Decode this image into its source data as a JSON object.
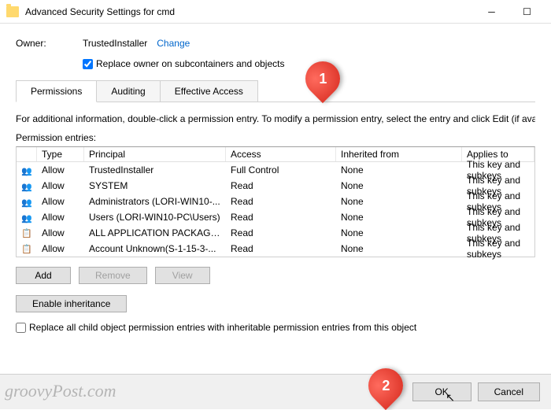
{
  "titlebar": {
    "title": "Advanced Security Settings for cmd"
  },
  "owner": {
    "label": "Owner:",
    "value": "TrustedInstaller",
    "change": "Change",
    "replace_checkbox": "Replace owner on subcontainers and objects",
    "replace_checked": true
  },
  "tabs": [
    {
      "label": "Permissions",
      "active": true
    },
    {
      "label": "Auditing",
      "active": false
    },
    {
      "label": "Effective Access",
      "active": false
    }
  ],
  "info": "For additional information, double-click a permission entry. To modify a permission entry, select the entry and click Edit (if availa",
  "entries_label": "Permission entries:",
  "columns": {
    "type": "Type",
    "principal": "Principal",
    "access": "Access",
    "inherited": "Inherited from",
    "applies": "Applies to"
  },
  "rows": [
    {
      "icon": "people",
      "type": "Allow",
      "principal": "TrustedInstaller",
      "access": "Full Control",
      "inherited": "None",
      "applies": "This key and subkeys"
    },
    {
      "icon": "people",
      "type": "Allow",
      "principal": "SYSTEM",
      "access": "Read",
      "inherited": "None",
      "applies": "This key and subkeys"
    },
    {
      "icon": "people",
      "type": "Allow",
      "principal": "Administrators (LORI-WIN10-...",
      "access": "Read",
      "inherited": "None",
      "applies": "This key and subkeys"
    },
    {
      "icon": "people",
      "type": "Allow",
      "principal": "Users (LORI-WIN10-PC\\Users)",
      "access": "Read",
      "inherited": "None",
      "applies": "This key and subkeys"
    },
    {
      "icon": "app",
      "type": "Allow",
      "principal": "ALL APPLICATION PACKAGES",
      "access": "Read",
      "inherited": "None",
      "applies": "This key and subkeys"
    },
    {
      "icon": "app",
      "type": "Allow",
      "principal": "Account Unknown(S-1-15-3-...",
      "access": "Read",
      "inherited": "None",
      "applies": "This key and subkeys"
    }
  ],
  "buttons": {
    "add": "Add",
    "remove": "Remove",
    "view": "View",
    "enable_inherit": "Enable inheritance",
    "ok": "OK",
    "cancel": "Cancel"
  },
  "replace_all_checkbox": "Replace all child object permission entries with inheritable permission entries from this object",
  "callouts": {
    "one": "1",
    "two": "2"
  },
  "watermark": "groovyPost.com"
}
